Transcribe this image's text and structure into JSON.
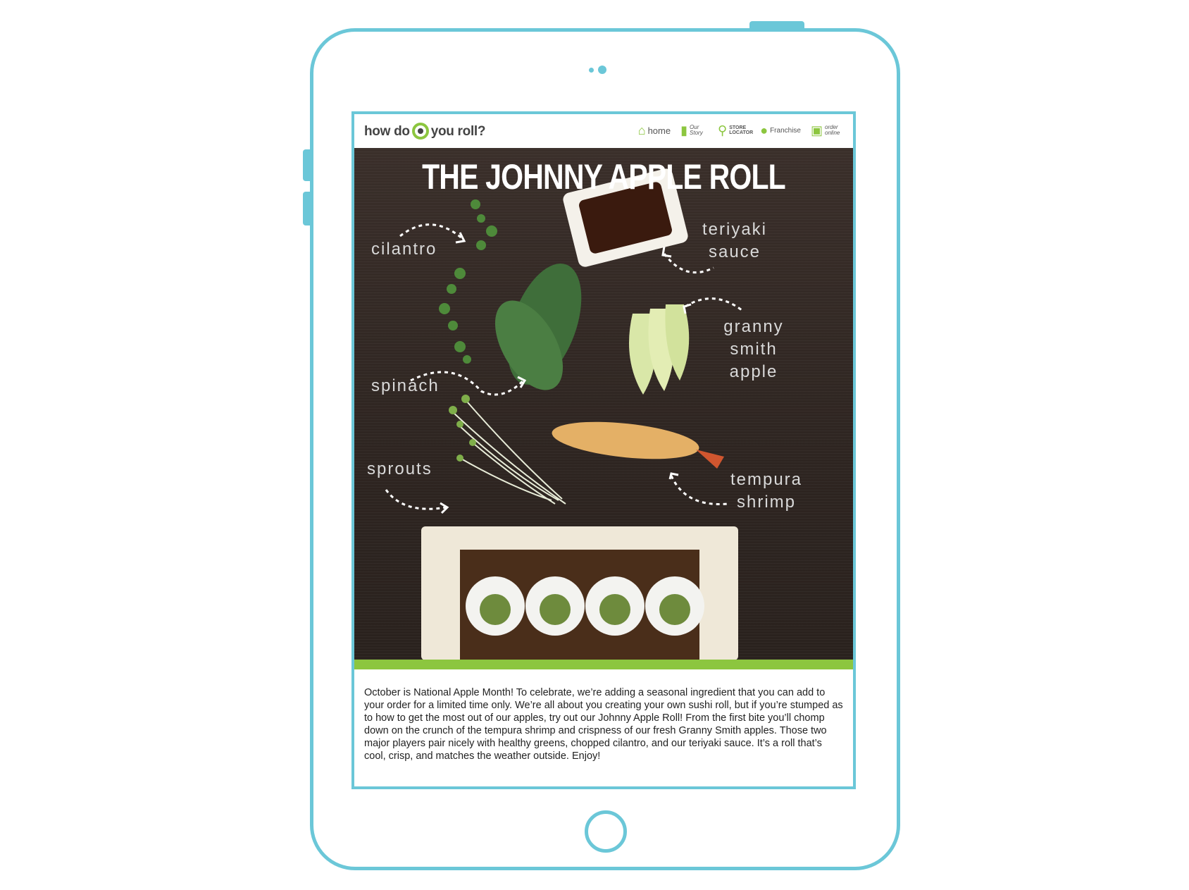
{
  "site": {
    "logo_text_1": "how do",
    "logo_text_2": "you roll?",
    "nav": [
      {
        "label": "home",
        "icon": "house-icon"
      },
      {
        "label": "Our Story",
        "icon": "book-icon"
      },
      {
        "label": "STORE LOCATOR",
        "icon": "map-pin-icon"
      },
      {
        "label": "Franchise",
        "icon": "people-icon"
      },
      {
        "label": "order online",
        "icon": "monitor-icon"
      }
    ]
  },
  "hero": {
    "title": "THE JOHNNY APPLE ROLL",
    "ingredients": {
      "cilantro": "cilantro",
      "teriyaki": "teriyaki sauce",
      "apple": "granny smith apple",
      "spinach": "spinach",
      "sprouts": "sprouts",
      "shrimp": "tempura shrimp"
    }
  },
  "article": {
    "text": " October is National Apple Month! To celebrate, we’re adding a seasonal ingredient that you can add to your order for a limited time only. We’re all about you creating your own sushi roll, but if you’re stumped as to how to get the most out of our apples, try out our Johnny Apple Roll! From the first bite you’ll chomp down on the crunch of the tempura shrimp and crispness of our fresh Granny Smith apples. Those two major players pair nicely with healthy greens, chopped cilantro, and our teriyaki sauce. It’s a roll that’s cool, crisp, and matches the weather outside. Enjoy!"
  },
  "colors": {
    "frame": "#6bc7d8",
    "brand_green": "#8cc63f",
    "hero_bg": "#2e2521"
  }
}
